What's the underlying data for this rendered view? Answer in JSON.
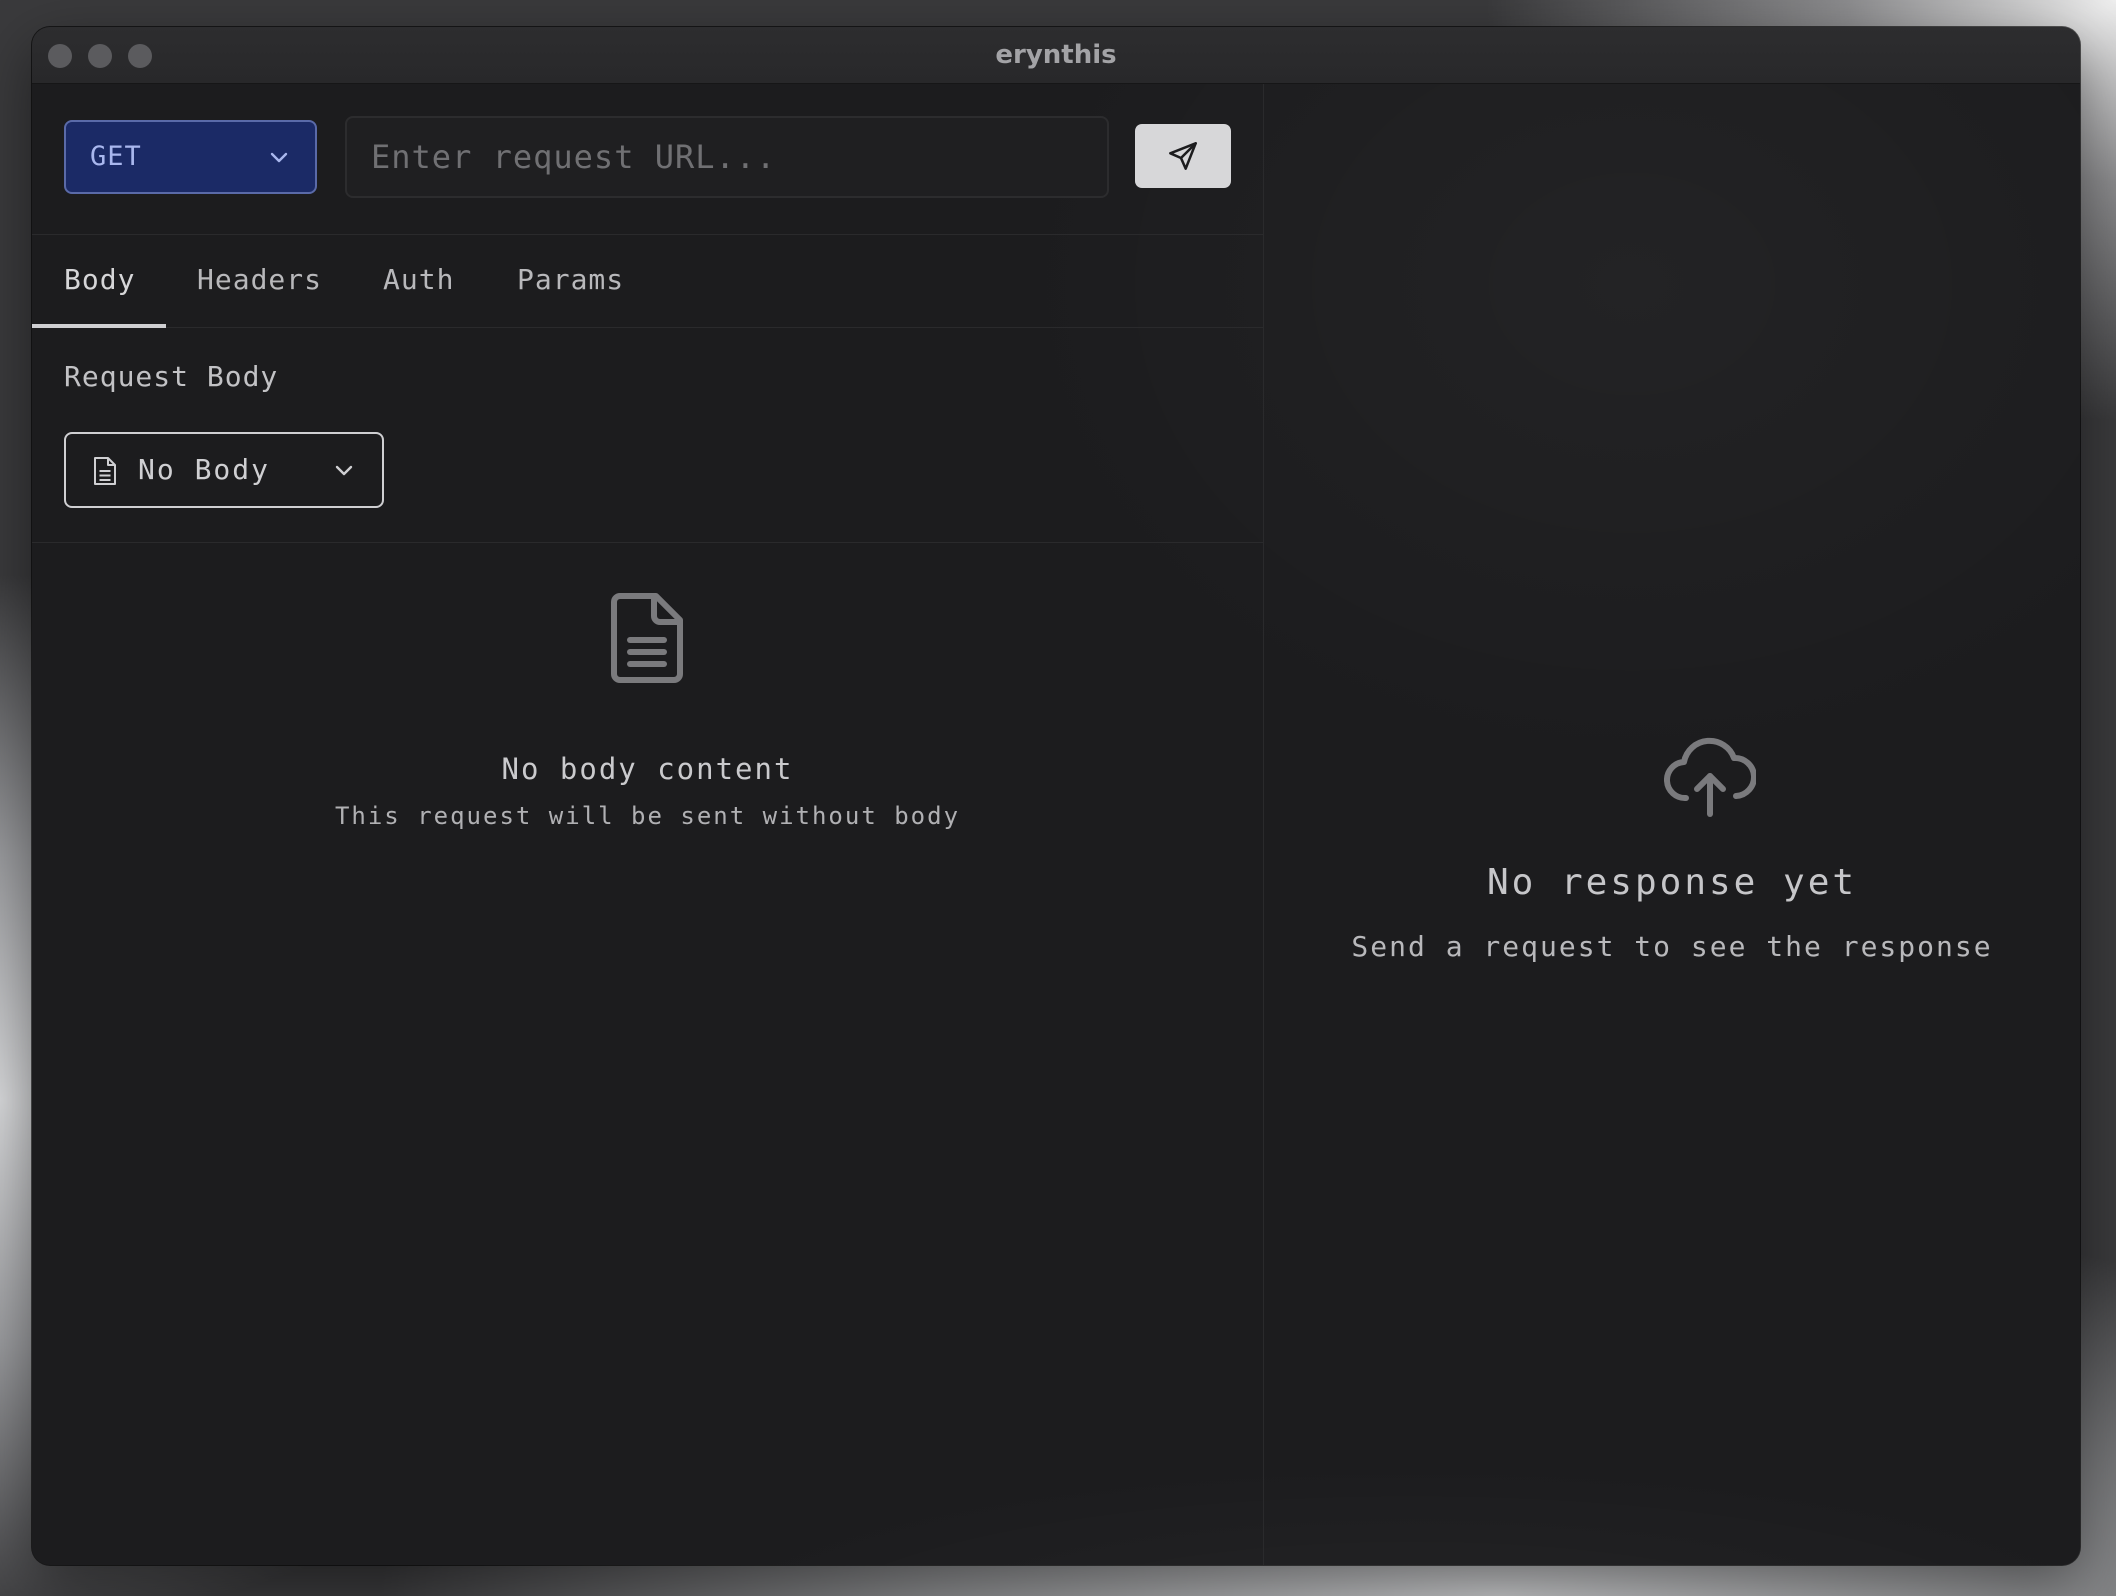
{
  "window": {
    "title": "erynthis"
  },
  "request": {
    "method": "GET",
    "url_value": "",
    "url_placeholder": "Enter request URL...",
    "send_icon": "paper-plane-icon"
  },
  "tabs": [
    {
      "label": "Body",
      "active": true
    },
    {
      "label": "Headers",
      "active": false
    },
    {
      "label": "Auth",
      "active": false
    },
    {
      "label": "Params",
      "active": false
    }
  ],
  "body": {
    "section_label": "Request Body",
    "selected_type": "No Body",
    "empty_title": "No body content",
    "empty_subtitle": "This request will be sent without body"
  },
  "response": {
    "empty_title": "No response yet",
    "empty_subtitle": "Send a request to see the response",
    "icon": "cloud-upload-icon"
  },
  "colors": {
    "method_bg": "#1b2a66",
    "method_text": "#a9b7ee",
    "send_button_bg": "#d7d7d9",
    "window_bg": "#1c1c1e"
  }
}
